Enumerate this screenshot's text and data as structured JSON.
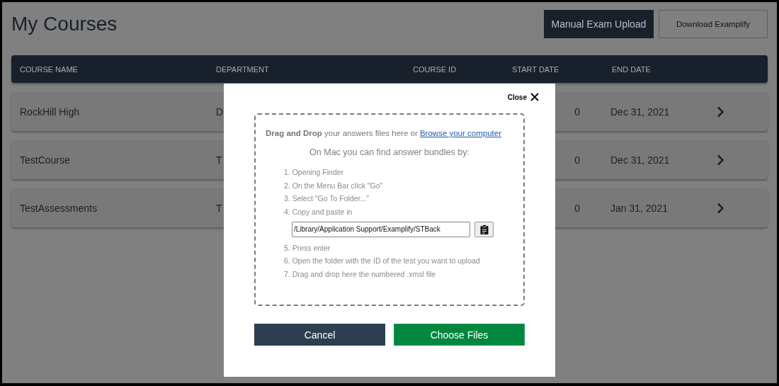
{
  "page": {
    "title": "My Courses"
  },
  "actions": [
    {
      "label": "Manual Exam Upload",
      "kind": "primary"
    },
    {
      "label": "Download Examplify",
      "kind": "outline"
    }
  ],
  "table": {
    "columns": [
      "COURSE NAME",
      "DEPARTMENT",
      "COURSE ID",
      "START DATE",
      "END DATE"
    ],
    "rows": [
      {
        "course_name": "RockHill High",
        "department": "D",
        "start_date": "0",
        "end_date": "Dec 31, 2021"
      },
      {
        "course_name": "TestCourse",
        "department": "T",
        "start_date": "0",
        "end_date": "Dec 31, 2021"
      },
      {
        "course_name": "TestAssessments",
        "department": "T",
        "start_date": "0",
        "end_date": "Jan 31, 2021"
      }
    ]
  },
  "dialog": {
    "close_label": "Close",
    "drop_text": "**Drag and Drop** your answers files here or ",
    "browse_link": "Browse your computer",
    "subtitle": "On Mac you can find answer bundles by:",
    "steps": [
      {
        "kind": "step",
        "text": "1. Opening Finder"
      },
      {
        "kind": "step",
        "text": "2. On the Menu Bar click \"Go\""
      },
      {
        "kind": "step",
        "text": "3. Select \"Go To Folder...\""
      },
      {
        "kind": "step",
        "text": "4. Copy and paste in"
      },
      {
        "kind": "path",
        "value": "/Library/Application Support/Examplify/STBack"
      },
      {
        "kind": "step",
        "text": "5. Press enter"
      },
      {
        "kind": "step",
        "text": "6. Open the folder with the ID of the test you want to upload"
      },
      {
        "kind": "step",
        "text": "7. Drag and drop here the numbered .xmsl file"
      }
    ],
    "buttons": [
      {
        "label": "Cancel",
        "kind": "secondary"
      },
      {
        "label": "Choose Files",
        "kind": "confirm"
      }
    ]
  }
}
